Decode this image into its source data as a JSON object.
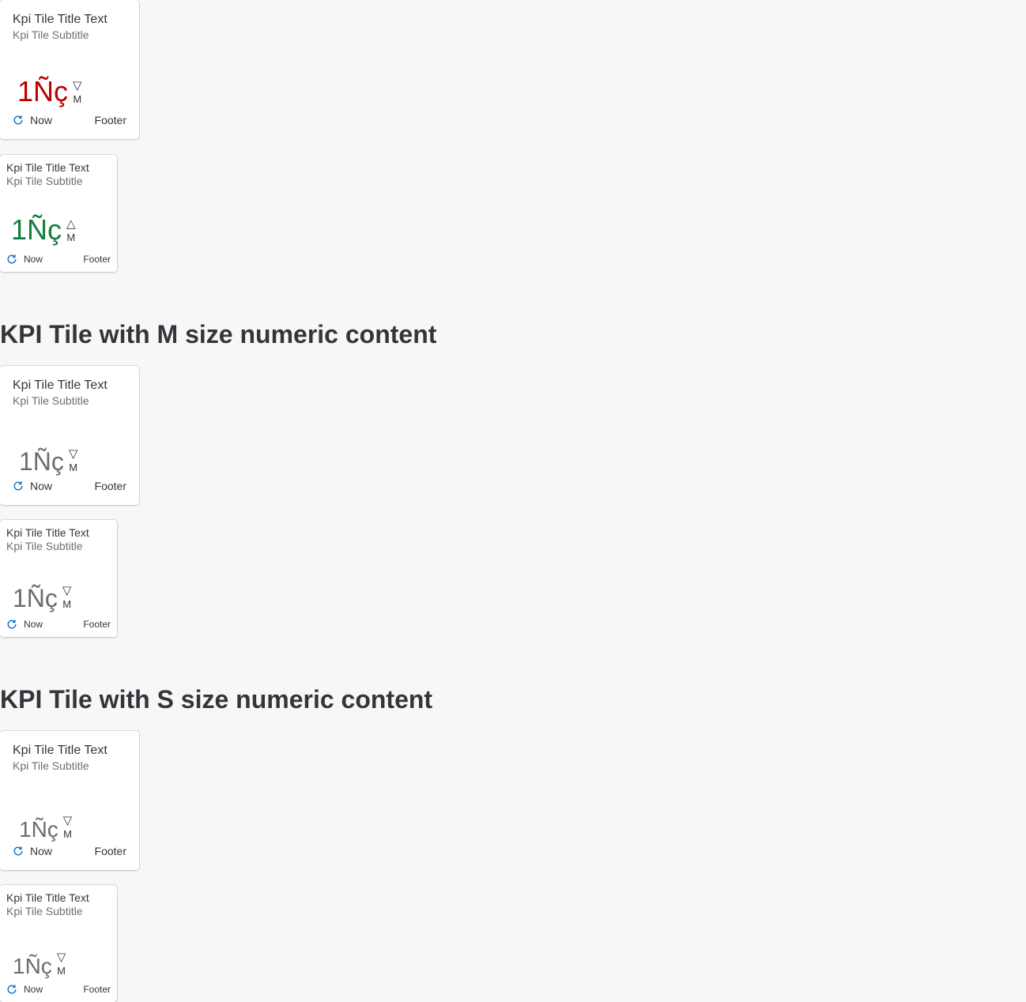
{
  "tile": {
    "title": "Kpi Tile Title Text",
    "subtitle": "Kpi Tile Subtitle",
    "value": "1Ñç",
    "scale": "M",
    "refresh_label": "Now",
    "footer": "Footer",
    "arrow_down": "▽",
    "arrow_up": "△"
  },
  "sections": {
    "m_title": "KPI Tile with M size numeric content",
    "s_title": "KPI Tile with S size numeric content"
  },
  "colors": {
    "negative": "#bb0000",
    "positive": "#107e3e",
    "neutral": "#6a6d70",
    "refresh_icon": "#0a6ed1"
  }
}
